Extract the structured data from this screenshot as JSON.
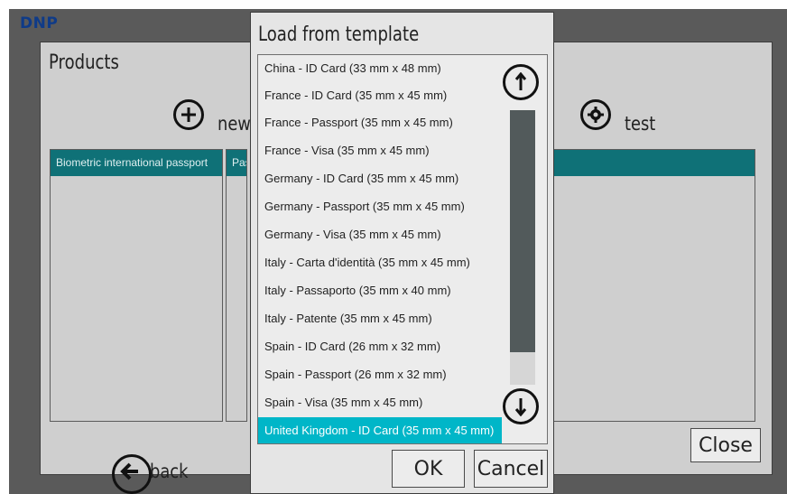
{
  "app": {
    "logo": "DNP",
    "products_title": "Products",
    "new_label": "new",
    "test_label": "test",
    "close_label": "Close",
    "back_label": "back",
    "columns": [
      {
        "header": "Biometric international passport"
      },
      {
        "header": "Pas"
      }
    ]
  },
  "dialog": {
    "title": "Load from template",
    "items": [
      "China - ID Card (33 mm x 48 mm)",
      "France - ID Card (35 mm x 45 mm)",
      "France - Passport (35 mm x 45 mm)",
      "France - Visa (35 mm x 45 mm)",
      "Germany - ID Card (35 mm x 45 mm)",
      "Germany - Passport (35 mm x 45 mm)",
      "Germany - Visa (35 mm x 45 mm)",
      "Italy - Carta d'identità (35 mm x 45 mm)",
      "Italy - Passaporto (35 mm x 40 mm)",
      "Italy - Patente (35 mm x 45 mm)",
      "Spain - ID Card (26 mm x 32 mm)",
      "Spain - Passport (26 mm x 32 mm)",
      "Spain - Visa (35 mm x 45 mm)",
      "United Kingdom - ID Card (35 mm x 45 mm)"
    ],
    "selected_item": "United Kingdom - ID Card (35 mm x 45 mm)",
    "ok_label": "OK",
    "cancel_label": "Cancel",
    "icons": {
      "scroll_up": "arrow-up-icon",
      "scroll_down": "arrow-down-icon"
    }
  },
  "colors": {
    "accent": "#00b6c8",
    "header_bg": "#0f7177",
    "backdrop": "#5a5a5a",
    "dialog_bg": "#e5e5e5"
  }
}
